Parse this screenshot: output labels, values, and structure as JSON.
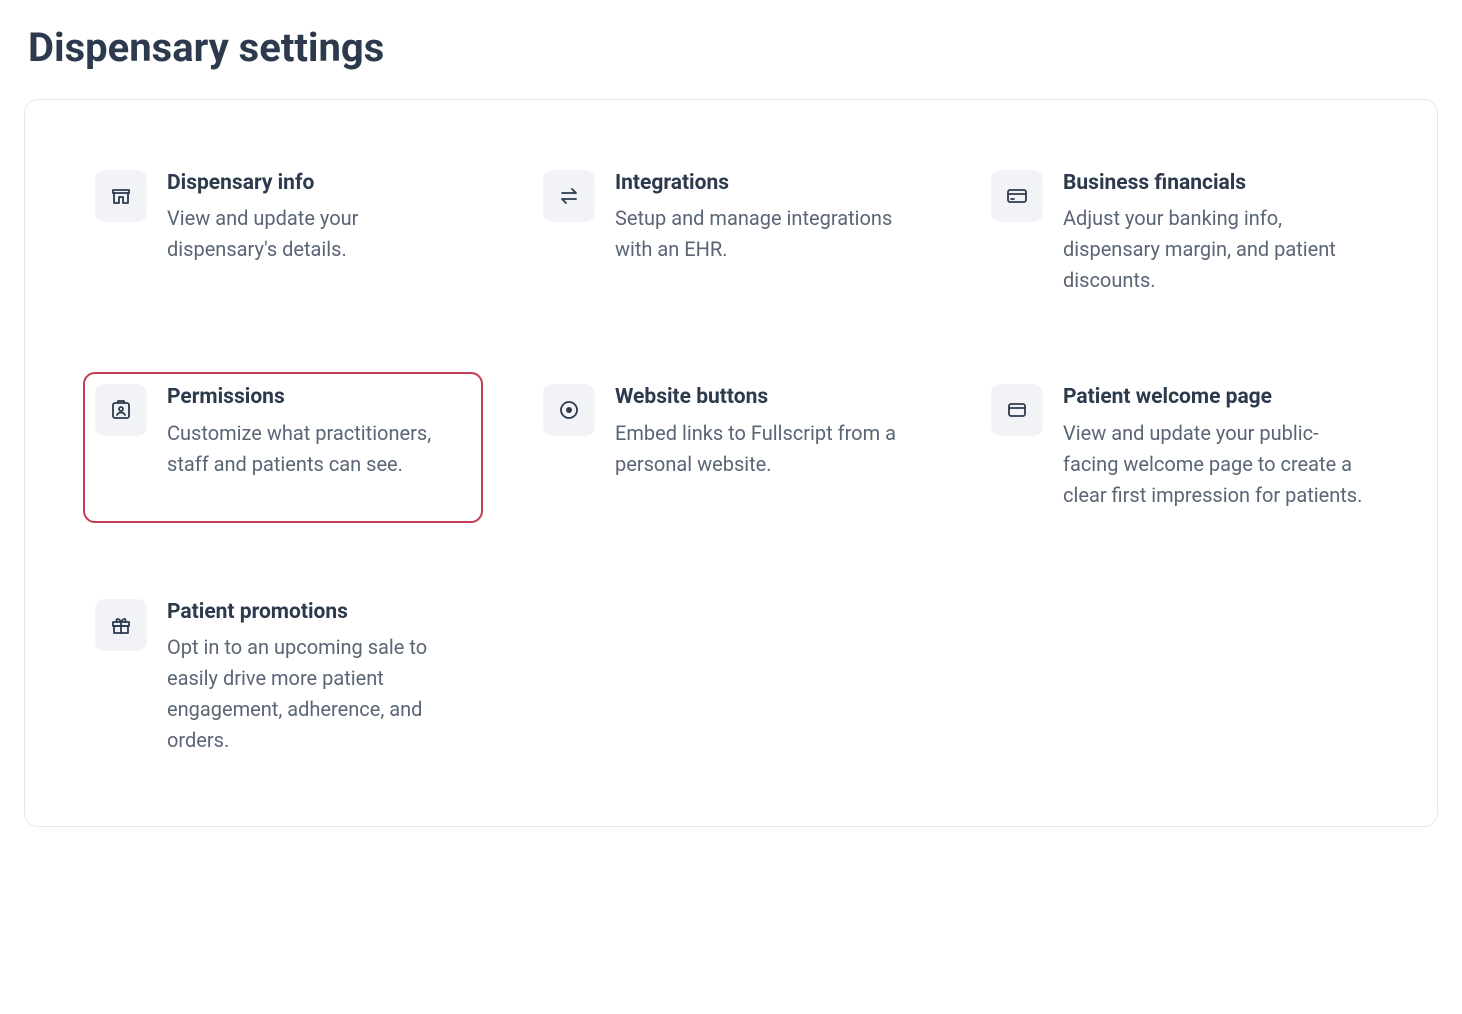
{
  "page": {
    "title": "Dispensary settings"
  },
  "cards": {
    "dispensary_info": {
      "title": "Dispensary info",
      "description": "View and update your dispensary's details."
    },
    "integrations": {
      "title": "Integrations",
      "description": "Setup and manage integrations with an EHR."
    },
    "business_financials": {
      "title": "Business financials",
      "description": "Adjust your banking info, dispensary margin, and patient discounts."
    },
    "permissions": {
      "title": "Permissions",
      "description": "Customize what practitioners, staff and patients can see."
    },
    "website_buttons": {
      "title": "Website buttons",
      "description": "Embed links to Fullscript from a personal website."
    },
    "patient_welcome": {
      "title": "Patient welcome page",
      "description": "View and update your public-facing welcome page to create a clear first impression for patients."
    },
    "patient_promotions": {
      "title": "Patient promotions",
      "description": "Opt in to an upcoming sale to easily drive more patient engagement, adherence, and orders."
    }
  }
}
